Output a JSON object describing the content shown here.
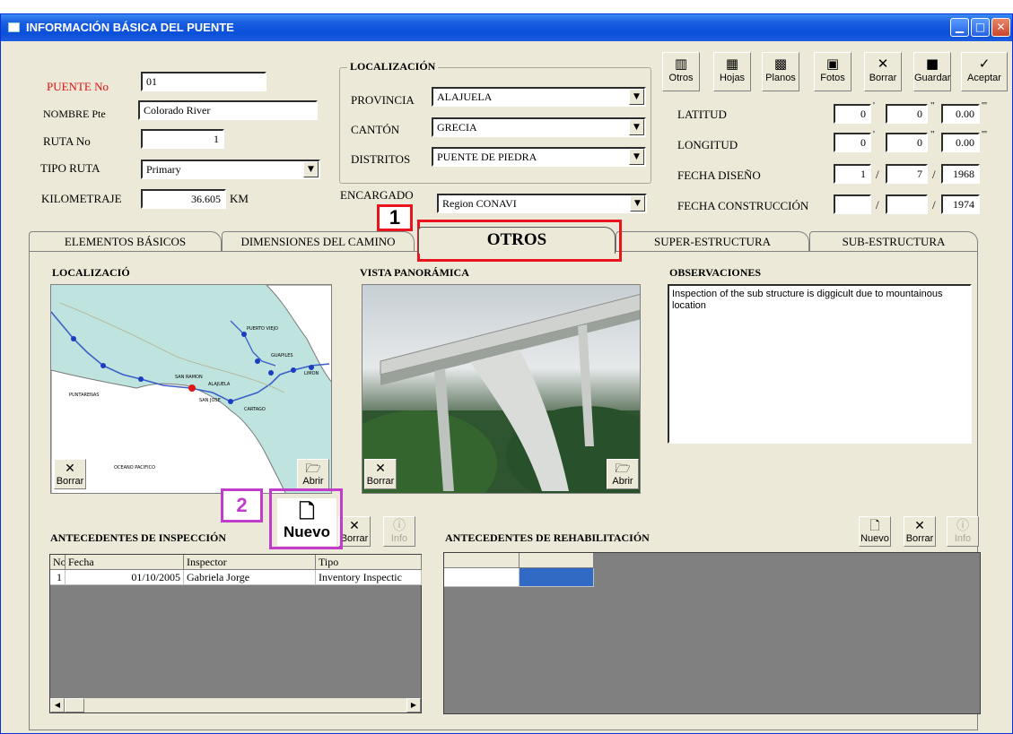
{
  "window": {
    "title": "INFORMACIÓN BÁSICA DEL PUENTE",
    "controls": [
      "minimize",
      "maximize",
      "close"
    ]
  },
  "bridge": {
    "puente_no_label": "PUENTE No",
    "puente_no": "01",
    "nombre_label": "NOMBRE Pte",
    "nombre": "Colorado River",
    "ruta_label": "RUTA No",
    "ruta": "1",
    "tipo_ruta_label": "TIPO RUTA",
    "tipo_ruta": "Primary",
    "km_label": "KILOMETRAJE",
    "km": "36.605",
    "km_unit": "KM"
  },
  "localizacion": {
    "group_label": "LOCALIZACIÓN",
    "provincia_label": "PROVINCIA",
    "provincia": "ALAJUELA",
    "canton_label": "CANTÓN",
    "canton": "GRECIA",
    "distritos_label": "DISTRITOS",
    "distritos": "PUENTE DE PIEDRA",
    "encargado_label": "ENCARGADO",
    "encargado": "Region CONAVI"
  },
  "toolbar": [
    "Otros",
    "Hojas",
    "Planos",
    "Fotos",
    "Borrar",
    "Guardar",
    "Aceptar"
  ],
  "coords": {
    "latitud_label": "LATITUD",
    "lat": [
      "0",
      "0",
      "0.00"
    ],
    "longitud_label": "LONGITUD",
    "lon": [
      "0",
      "0",
      "0.00"
    ],
    "fecha_diseno_label": "FECHA DISEÑO",
    "diseno": [
      "1",
      "7",
      "1968"
    ],
    "fecha_const_label": "FECHA CONSTRUCCIÓN",
    "construccion": [
      "",
      "",
      "1974"
    ],
    "sep_deg": "'",
    "sep_min": "\"",
    "sep_sec": "'''",
    "date_sep": "/"
  },
  "tabs": [
    "ELEMENTOS BÁSICOS",
    "DIMENSIONES DEL CAMINO",
    "OTROS",
    "SUPER-ESTRUCTURA",
    "SUB-ESTRUCTURA"
  ],
  "active_tab": "OTROS",
  "otros": {
    "localizacion_title": "LOCALIZACIÓ",
    "vista_title": "VISTA PANORÁMICA",
    "observaciones_title": "OBSERVACIONES",
    "observaciones": "Inspection of the sub structure is diggicult due to mountainous location",
    "borrar": "Borrar",
    "abrir": "Abrir",
    "map_labels": [
      "PUERTO VIEJO",
      "GUAPILES",
      "SAN RAMON",
      "ALAJUELA",
      "SAN JOSE",
      "CARTAGO",
      "PUNTARENAS",
      "OCEANO PACIFICO",
      "LIMON"
    ]
  },
  "inspeccion": {
    "title": "ANTECEDENTES DE INSPECCIÓN",
    "nuevo": "Nuevo",
    "borrar": "Borrar",
    "info": "Info",
    "columns": [
      "No",
      "Fecha",
      "Inspector",
      "Tipo"
    ],
    "rows": [
      {
        "no": "1",
        "fecha": "01/10/2005",
        "inspector": "Gabriela Jorge",
        "tipo": "Inventory Inspectic"
      }
    ]
  },
  "rehabilitacion": {
    "title": "ANTECEDENTES DE REHABILITACIÓN",
    "nuevo": "Nuevo",
    "borrar": "Borrar",
    "info": "Info"
  },
  "callouts": [
    {
      "num": "1",
      "color": "#e8151f"
    },
    {
      "num": "2",
      "color": "#c23ccc"
    }
  ]
}
